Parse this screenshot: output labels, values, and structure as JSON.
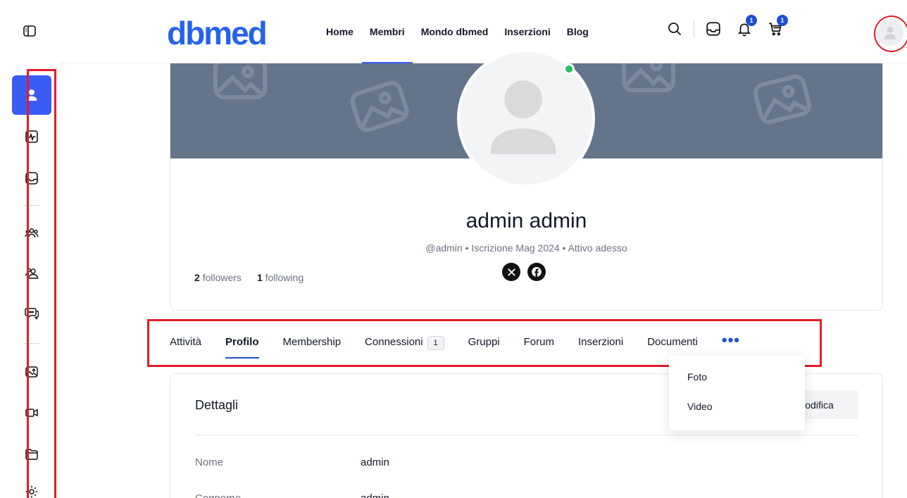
{
  "brand": {
    "logo_text": "dbmed",
    "accent": "#3b5bf5",
    "logo_color": "#2563eb"
  },
  "nav": [
    {
      "label": "Home",
      "active": false
    },
    {
      "label": "Membri",
      "active": true
    },
    {
      "label": "Mondo dbmed",
      "active": false
    },
    {
      "label": "Inserzioni",
      "active": false
    },
    {
      "label": "Blog",
      "active": false
    }
  ],
  "header_icons": {
    "search": "search-icon",
    "inbox": "inbox-icon",
    "notifications": {
      "icon": "bell-icon",
      "badge": "1"
    },
    "cart": {
      "icon": "cart-icon",
      "badge": "1"
    },
    "avatar": "user-avatar-icon"
  },
  "sidebar": {
    "toggle_icon": "sidebar-toggle-icon",
    "items": [
      {
        "icon": "user-icon",
        "active": true
      },
      {
        "icon": "activity-icon",
        "active": false
      },
      {
        "icon": "inbox-icon",
        "active": false
      },
      {
        "icon": "groups-icon",
        "active": false
      },
      {
        "icon": "connections-icon",
        "active": false
      },
      {
        "icon": "messages-icon",
        "active": false
      },
      {
        "icon": "photos-icon",
        "active": false
      },
      {
        "icon": "video-icon",
        "active": false
      },
      {
        "icon": "folder-icon",
        "active": false
      },
      {
        "icon": "gear-icon",
        "active": false
      }
    ]
  },
  "profile": {
    "name": "admin admin",
    "meta": "@admin • Iscrizione Mag 2024 • Attivo adesso",
    "followers_count": "2",
    "followers_label": "followers",
    "following_count": "1",
    "following_label": "following",
    "online": true,
    "socials": [
      "x-icon",
      "facebook-icon"
    ]
  },
  "tabs": [
    {
      "label": "Attività",
      "active": false
    },
    {
      "label": "Profilo",
      "active": true
    },
    {
      "label": "Membership",
      "active": false
    },
    {
      "label": "Connessioni",
      "active": false,
      "count": "1"
    },
    {
      "label": "Gruppi",
      "active": false
    },
    {
      "label": "Forum",
      "active": false
    },
    {
      "label": "Inserzioni",
      "active": false
    },
    {
      "label": "Documenti",
      "active": false
    }
  ],
  "tabs_more": "•••",
  "more_menu": [
    {
      "label": "Foto"
    },
    {
      "label": "Video"
    }
  ],
  "details": {
    "title": "Dettagli",
    "edit_label": "odifica",
    "fields": [
      {
        "label": "Nome",
        "value": "admin"
      },
      {
        "label": "Cognome",
        "value": "admin"
      }
    ]
  },
  "annotation_color": "#e11d2a"
}
